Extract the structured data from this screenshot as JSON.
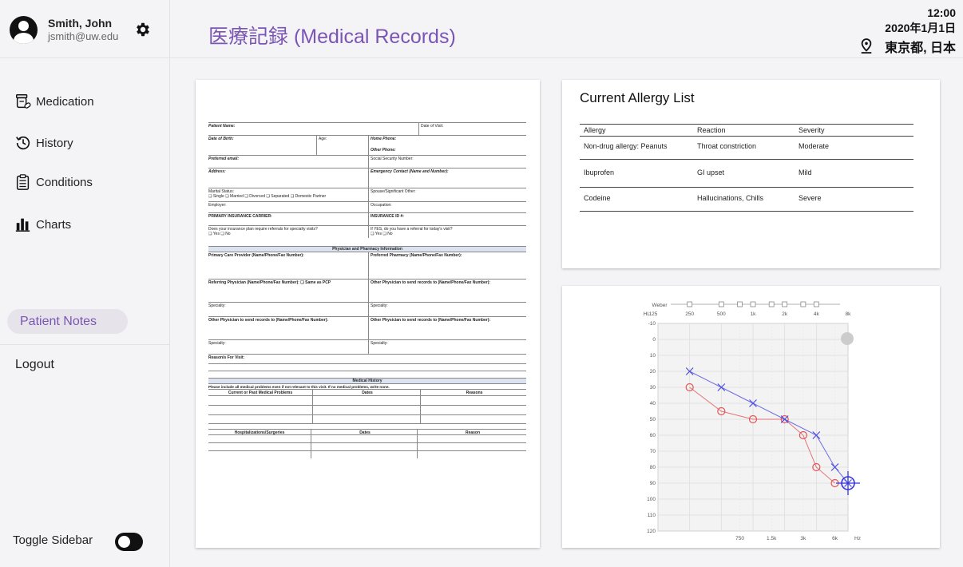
{
  "user": {
    "name": "Smith, John",
    "email": "jsmith@uw.edu"
  },
  "nav": {
    "items": [
      {
        "label": "Medication",
        "icon": "medication-icon"
      },
      {
        "label": "History",
        "icon": "history-icon"
      },
      {
        "label": "Conditions",
        "icon": "clipboard-icon"
      },
      {
        "label": "Charts",
        "icon": "bar-chart-icon"
      }
    ],
    "patient_notes": "Patient Notes",
    "logout": "Logout",
    "toggle_sidebar": "Toggle Sidebar"
  },
  "header": {
    "title": "医療記録 (Medical Records)",
    "time": "12:00",
    "date": "2020年1月1日",
    "location": "東京都, 日本"
  },
  "form": {
    "patient_name": "Patient Name:",
    "date_of_visit": "Date of Visit:",
    "dob": "Date of Birth:",
    "age": "Age:",
    "home_phone": "Home Phone:",
    "other_phone": "Other Phone:",
    "pref_email": "Preferred email:",
    "ssn": "Social Security Number:",
    "address": "Address:",
    "emergency": "Emergency Contact (Name and Number):",
    "marital": "Marital Status:",
    "marital_opts": "❑ Single  ❑ Married  ❑ Divorced  ❑ Separated  ❑ Domestic Partner",
    "spouse": "Spouse/Significant Other:",
    "employer": "Employer:",
    "occupation": "Occupation:",
    "primary_ins": "PRIMARY INSURANCE CARRIER:",
    "ins_id": "INSURANCE ID #:",
    "referral_q": "Does your insurance plan require referrals for specialty visits?",
    "referral_opts": "❑ Yes  ❑ No",
    "referral_q2": "If YES, do you have a referral for today's visit?",
    "referral_opts2": "❑ Yes  ❑ No",
    "phys_header": "Physician and Pharmacy Information",
    "pcp": "Primary Care Provider (Name/Phone/Fax Number):",
    "pharmacy": "Preferred Pharmacy (Name/Phone/Fax Number):",
    "ref_phys": "Referring Physician (Name/Phone/Fax Number):   ❑ Same as PCP",
    "other_phys": "Other Physician to send records to (Name/Phone/Fax Number):",
    "specialty": "Specialty:",
    "reason": "Reason/s For Visit:",
    "med_hist": "Medical History",
    "med_note": "Please include all medical problems even if not relevant to this visit.  If no medical problems, write none.",
    "col_problems": "Current or Past Medical Problems",
    "col_dates": "Dates",
    "col_reasons": "Reasons",
    "col_hosp": "Hospitalizations/Surgeries",
    "col_reason": "Reason"
  },
  "allergies": {
    "title": "Current Allergy List",
    "headers": [
      "Allergy",
      "Reaction",
      "Severity"
    ],
    "rows": [
      [
        "Non-drug allergy: Peanuts",
        "Throat constriction",
        "Moderate"
      ],
      [
        "Ibuprofen",
        "GI upset",
        "Mild"
      ],
      [
        "Codeine",
        "Hallucinations, Chills",
        "Severe"
      ]
    ]
  },
  "chart_data": {
    "type": "line",
    "title": "",
    "xlabel": "Hz",
    "ylabel": "HL",
    "top_tick_labels": [
      "125",
      "250",
      "500",
      "1k",
      "2k",
      "4k",
      "8k"
    ],
    "bottom_tick_labels": [
      "750",
      "1.5k",
      "3k",
      "6k"
    ],
    "y_ticks": [
      -10,
      0,
      10,
      20,
      30,
      40,
      50,
      60,
      70,
      80,
      90,
      100,
      110,
      120
    ],
    "ylim": [
      -10,
      120
    ],
    "weber_label": "Weber",
    "x": [
      250,
      500,
      1000,
      2000,
      3000,
      4000,
      6000,
      8000
    ],
    "series": [
      {
        "marker": "circle",
        "color": "#e05555",
        "values": [
          30,
          45,
          50,
          50,
          60,
          80,
          90,
          null
        ]
      },
      {
        "marker": "cross",
        "color": "#4b4be0",
        "values": [
          20,
          30,
          40,
          50,
          null,
          60,
          80,
          90
        ]
      }
    ]
  }
}
